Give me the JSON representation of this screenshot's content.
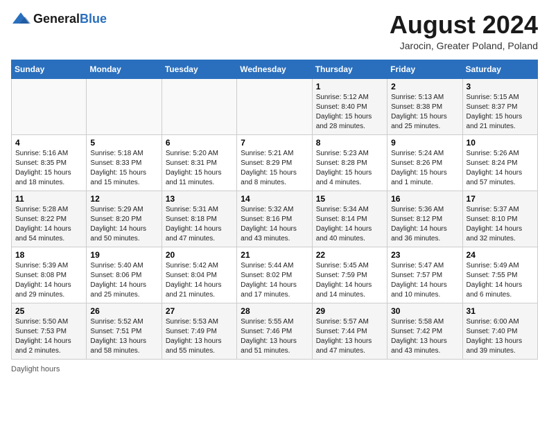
{
  "header": {
    "logo_general": "General",
    "logo_blue": "Blue",
    "title": "August 2024",
    "subtitle": "Jarocin, Greater Poland, Poland"
  },
  "calendar": {
    "days_of_week": [
      "Sunday",
      "Monday",
      "Tuesday",
      "Wednesday",
      "Thursday",
      "Friday",
      "Saturday"
    ],
    "weeks": [
      [
        {
          "day": "",
          "info": ""
        },
        {
          "day": "",
          "info": ""
        },
        {
          "day": "",
          "info": ""
        },
        {
          "day": "",
          "info": ""
        },
        {
          "day": "1",
          "info": "Sunrise: 5:12 AM\nSunset: 8:40 PM\nDaylight: 15 hours\nand 28 minutes."
        },
        {
          "day": "2",
          "info": "Sunrise: 5:13 AM\nSunset: 8:38 PM\nDaylight: 15 hours\nand 25 minutes."
        },
        {
          "day": "3",
          "info": "Sunrise: 5:15 AM\nSunset: 8:37 PM\nDaylight: 15 hours\nand 21 minutes."
        }
      ],
      [
        {
          "day": "4",
          "info": "Sunrise: 5:16 AM\nSunset: 8:35 PM\nDaylight: 15 hours\nand 18 minutes."
        },
        {
          "day": "5",
          "info": "Sunrise: 5:18 AM\nSunset: 8:33 PM\nDaylight: 15 hours\nand 15 minutes."
        },
        {
          "day": "6",
          "info": "Sunrise: 5:20 AM\nSunset: 8:31 PM\nDaylight: 15 hours\nand 11 minutes."
        },
        {
          "day": "7",
          "info": "Sunrise: 5:21 AM\nSunset: 8:29 PM\nDaylight: 15 hours\nand 8 minutes."
        },
        {
          "day": "8",
          "info": "Sunrise: 5:23 AM\nSunset: 8:28 PM\nDaylight: 15 hours\nand 4 minutes."
        },
        {
          "day": "9",
          "info": "Sunrise: 5:24 AM\nSunset: 8:26 PM\nDaylight: 15 hours\nand 1 minute."
        },
        {
          "day": "10",
          "info": "Sunrise: 5:26 AM\nSunset: 8:24 PM\nDaylight: 14 hours\nand 57 minutes."
        }
      ],
      [
        {
          "day": "11",
          "info": "Sunrise: 5:28 AM\nSunset: 8:22 PM\nDaylight: 14 hours\nand 54 minutes."
        },
        {
          "day": "12",
          "info": "Sunrise: 5:29 AM\nSunset: 8:20 PM\nDaylight: 14 hours\nand 50 minutes."
        },
        {
          "day": "13",
          "info": "Sunrise: 5:31 AM\nSunset: 8:18 PM\nDaylight: 14 hours\nand 47 minutes."
        },
        {
          "day": "14",
          "info": "Sunrise: 5:32 AM\nSunset: 8:16 PM\nDaylight: 14 hours\nand 43 minutes."
        },
        {
          "day": "15",
          "info": "Sunrise: 5:34 AM\nSunset: 8:14 PM\nDaylight: 14 hours\nand 40 minutes."
        },
        {
          "day": "16",
          "info": "Sunrise: 5:36 AM\nSunset: 8:12 PM\nDaylight: 14 hours\nand 36 minutes."
        },
        {
          "day": "17",
          "info": "Sunrise: 5:37 AM\nSunset: 8:10 PM\nDaylight: 14 hours\nand 32 minutes."
        }
      ],
      [
        {
          "day": "18",
          "info": "Sunrise: 5:39 AM\nSunset: 8:08 PM\nDaylight: 14 hours\nand 29 minutes."
        },
        {
          "day": "19",
          "info": "Sunrise: 5:40 AM\nSunset: 8:06 PM\nDaylight: 14 hours\nand 25 minutes."
        },
        {
          "day": "20",
          "info": "Sunrise: 5:42 AM\nSunset: 8:04 PM\nDaylight: 14 hours\nand 21 minutes."
        },
        {
          "day": "21",
          "info": "Sunrise: 5:44 AM\nSunset: 8:02 PM\nDaylight: 14 hours\nand 17 minutes."
        },
        {
          "day": "22",
          "info": "Sunrise: 5:45 AM\nSunset: 7:59 PM\nDaylight: 14 hours\nand 14 minutes."
        },
        {
          "day": "23",
          "info": "Sunrise: 5:47 AM\nSunset: 7:57 PM\nDaylight: 14 hours\nand 10 minutes."
        },
        {
          "day": "24",
          "info": "Sunrise: 5:49 AM\nSunset: 7:55 PM\nDaylight: 14 hours\nand 6 minutes."
        }
      ],
      [
        {
          "day": "25",
          "info": "Sunrise: 5:50 AM\nSunset: 7:53 PM\nDaylight: 14 hours\nand 2 minutes."
        },
        {
          "day": "26",
          "info": "Sunrise: 5:52 AM\nSunset: 7:51 PM\nDaylight: 13 hours\nand 58 minutes."
        },
        {
          "day": "27",
          "info": "Sunrise: 5:53 AM\nSunset: 7:49 PM\nDaylight: 13 hours\nand 55 minutes."
        },
        {
          "day": "28",
          "info": "Sunrise: 5:55 AM\nSunset: 7:46 PM\nDaylight: 13 hours\nand 51 minutes."
        },
        {
          "day": "29",
          "info": "Sunrise: 5:57 AM\nSunset: 7:44 PM\nDaylight: 13 hours\nand 47 minutes."
        },
        {
          "day": "30",
          "info": "Sunrise: 5:58 AM\nSunset: 7:42 PM\nDaylight: 13 hours\nand 43 minutes."
        },
        {
          "day": "31",
          "info": "Sunrise: 6:00 AM\nSunset: 7:40 PM\nDaylight: 13 hours\nand 39 minutes."
        }
      ]
    ]
  },
  "footer": {
    "note": "Daylight hours"
  }
}
